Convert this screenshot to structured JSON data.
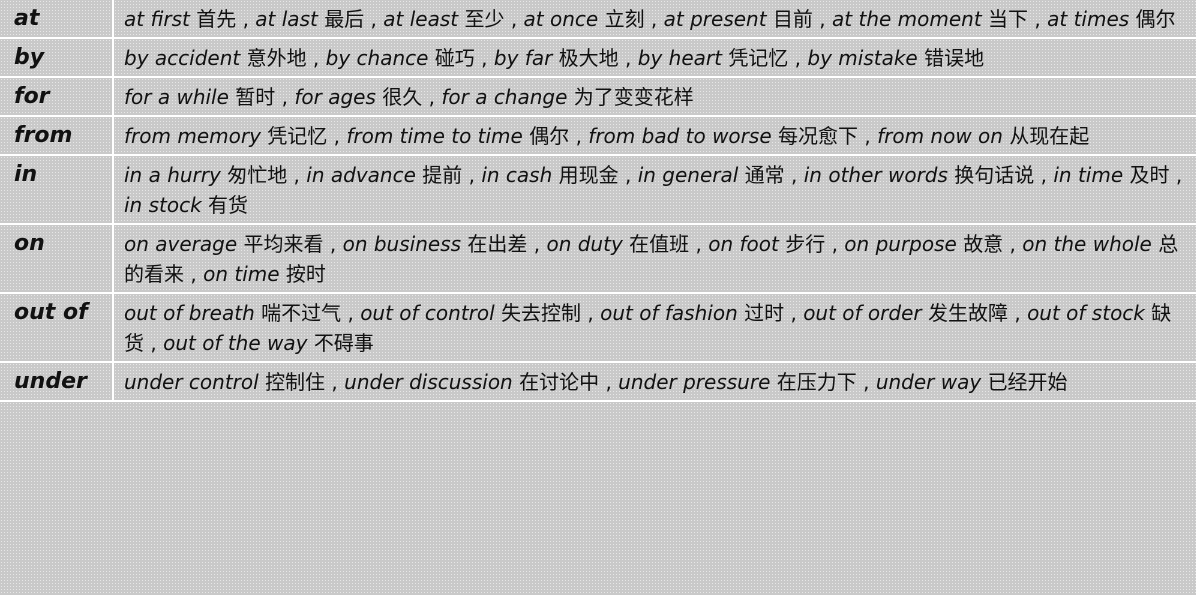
{
  "rows": [
    {
      "prep": "at",
      "phrases": [
        {
          "en": "at first",
          "zh": "首先"
        },
        {
          "en": "at last",
          "zh": "最后"
        },
        {
          "en": "at least",
          "zh": "至少"
        },
        {
          "en": "at once",
          "zh": "立刻"
        },
        {
          "en": "at present",
          "zh": "目前"
        },
        {
          "en": "at the moment",
          "zh": "当下"
        },
        {
          "en": "at times",
          "zh": "偶尔"
        }
      ]
    },
    {
      "prep": "by",
      "phrases": [
        {
          "en": "by accident",
          "zh": "意外地"
        },
        {
          "en": "by chance",
          "zh": "碰巧"
        },
        {
          "en": "by far",
          "zh": "极大地"
        },
        {
          "en": "by heart",
          "zh": "凭记忆"
        },
        {
          "en": "by mistake",
          "zh": "错误地"
        }
      ]
    },
    {
      "prep": "for",
      "phrases": [
        {
          "en": "for a while",
          "zh": "暂时"
        },
        {
          "en": "for ages",
          "zh": "很久"
        },
        {
          "en": "for a change",
          "zh": "为了变变花样"
        }
      ]
    },
    {
      "prep": "from",
      "phrases": [
        {
          "en": "from memory",
          "zh": "凭记忆"
        },
        {
          "en": "from time to time",
          "zh": "偶尔"
        },
        {
          "en": "from bad to worse",
          "zh": "每况愈下"
        },
        {
          "en": "from now on",
          "zh": "从现在起"
        }
      ]
    },
    {
      "prep": "in",
      "phrases": [
        {
          "en": "in a hurry",
          "zh": "匆忙地"
        },
        {
          "en": "in advance",
          "zh": "提前"
        },
        {
          "en": "in cash",
          "zh": "用现金"
        },
        {
          "en": "in general",
          "zh": "通常"
        },
        {
          "en": "in other words",
          "zh": "换句话说"
        },
        {
          "en": "in time",
          "zh": "及时"
        },
        {
          "en": "in stock",
          "zh": "有货"
        }
      ]
    },
    {
      "prep": "on",
      "phrases": [
        {
          "en": "on average",
          "zh": "平均来看"
        },
        {
          "en": "on business",
          "zh": "在出差"
        },
        {
          "en": "on duty",
          "zh": "在值班"
        },
        {
          "en": "on foot",
          "zh": "步行"
        },
        {
          "en": "on purpose",
          "zh": "故意"
        },
        {
          "en": "on the whole",
          "zh": "总的看来"
        },
        {
          "en": "on time",
          "zh": "按时"
        }
      ]
    },
    {
      "prep": "out of",
      "phrases": [
        {
          "en": "out of breath",
          "zh": "喘不过气"
        },
        {
          "en": "out of control",
          "zh": "失去控制"
        },
        {
          "en": "out of fashion",
          "zh": "过时"
        },
        {
          "en": "out of order",
          "zh": "发生故障"
        },
        {
          "en": "out of stock",
          "zh": "缺货"
        },
        {
          "en": "out of the way",
          "zh": "不碍事"
        }
      ]
    },
    {
      "prep": "under",
      "phrases": [
        {
          "en": "under control",
          "zh": "控制住"
        },
        {
          "en": "under discussion",
          "zh": "在讨论中"
        },
        {
          "en": "under pressure",
          "zh": "在压力下"
        },
        {
          "en": "under way",
          "zh": "已经开始"
        }
      ]
    }
  ]
}
